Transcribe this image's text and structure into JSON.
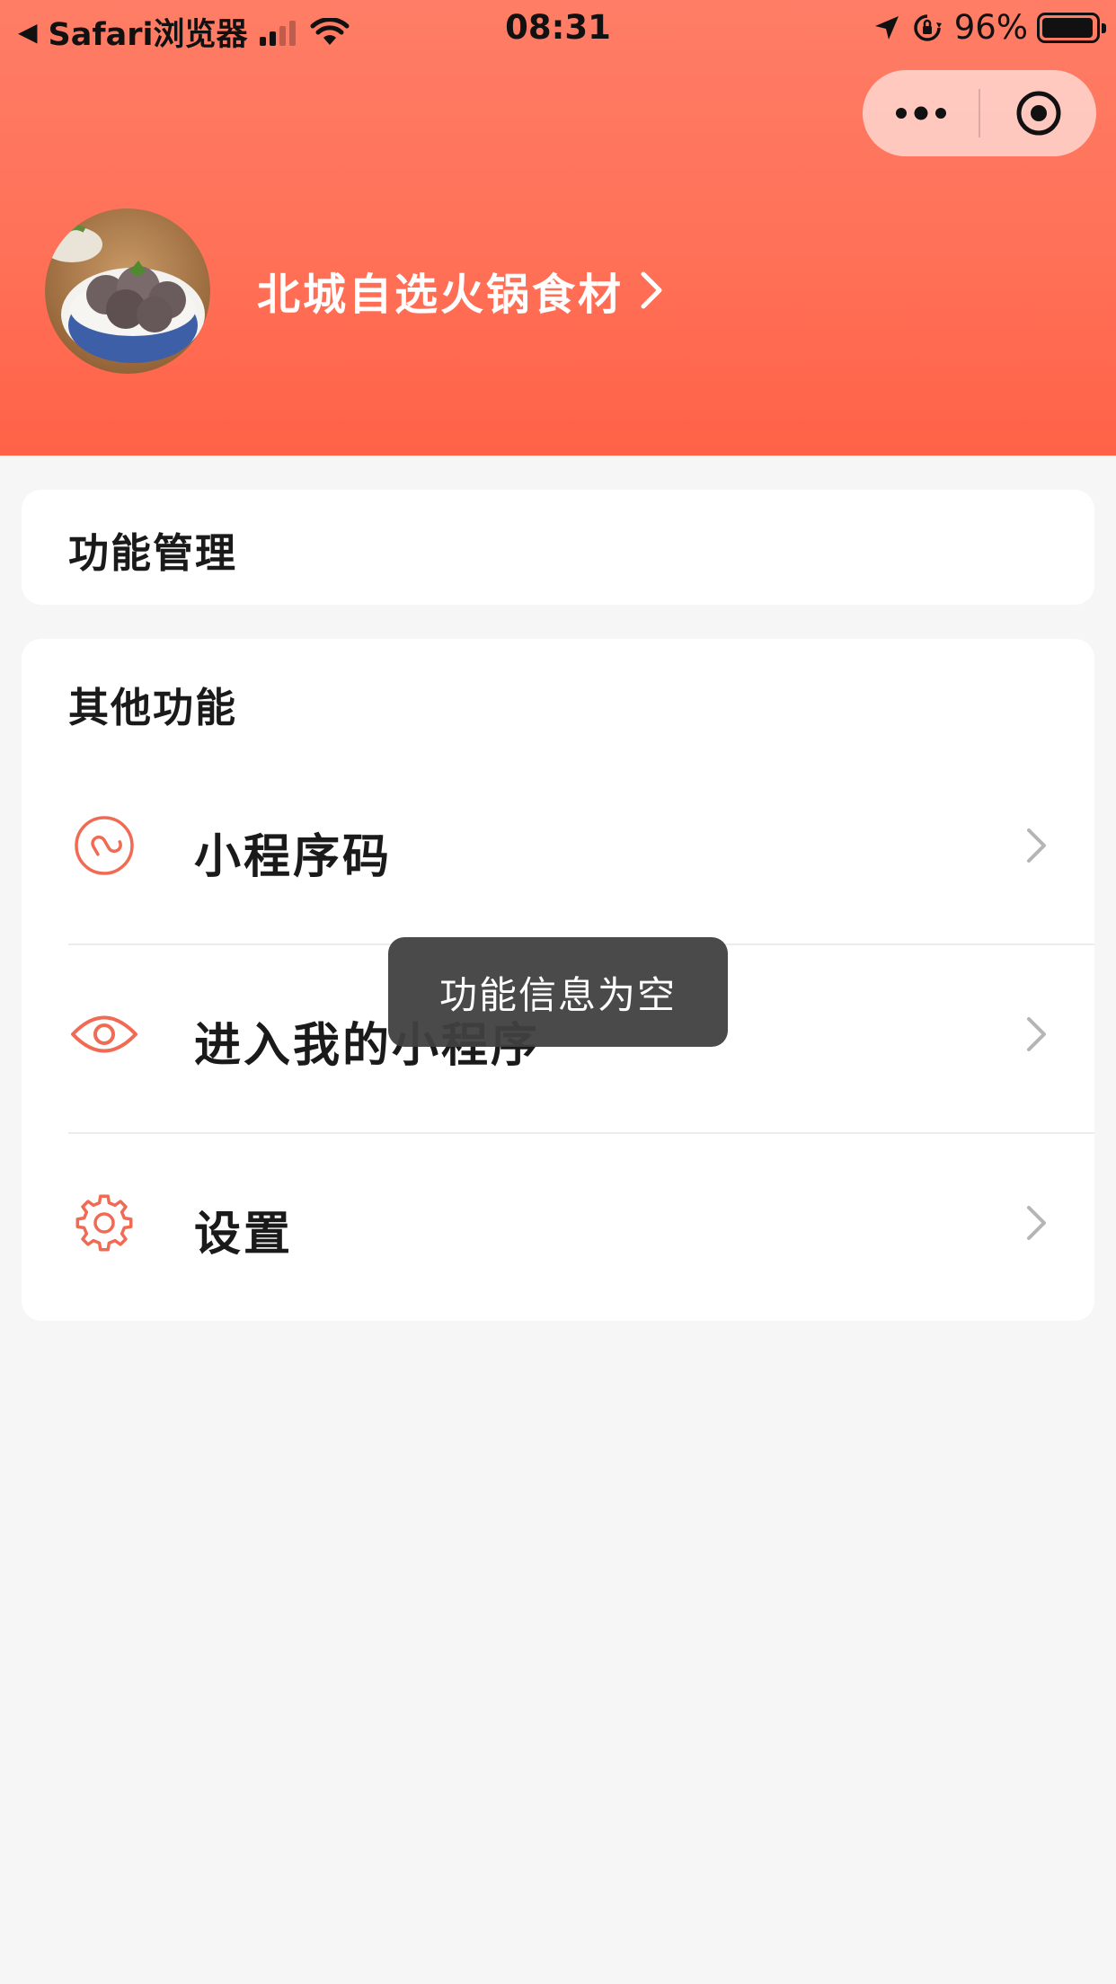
{
  "status_bar": {
    "back_app": "Safari浏览器",
    "time": "08:31",
    "battery": "96%",
    "battery_level": 0.96
  },
  "capsule": {
    "more_icon": "more-dots-icon",
    "close_icon": "target-icon"
  },
  "header": {
    "shop_name": "北城自选火锅食材",
    "accent": "#ff6a50"
  },
  "sections": {
    "function_management": "功能管理",
    "other_functions": {
      "title": "其他功能",
      "items": [
        {
          "label": "小程序码",
          "icon": "mini-program-link-icon"
        },
        {
          "label": "进入我的小程序",
          "icon": "eye-icon"
        },
        {
          "label": "设置",
          "icon": "gear-icon"
        }
      ]
    }
  },
  "toast": {
    "message": "功能信息为空"
  }
}
